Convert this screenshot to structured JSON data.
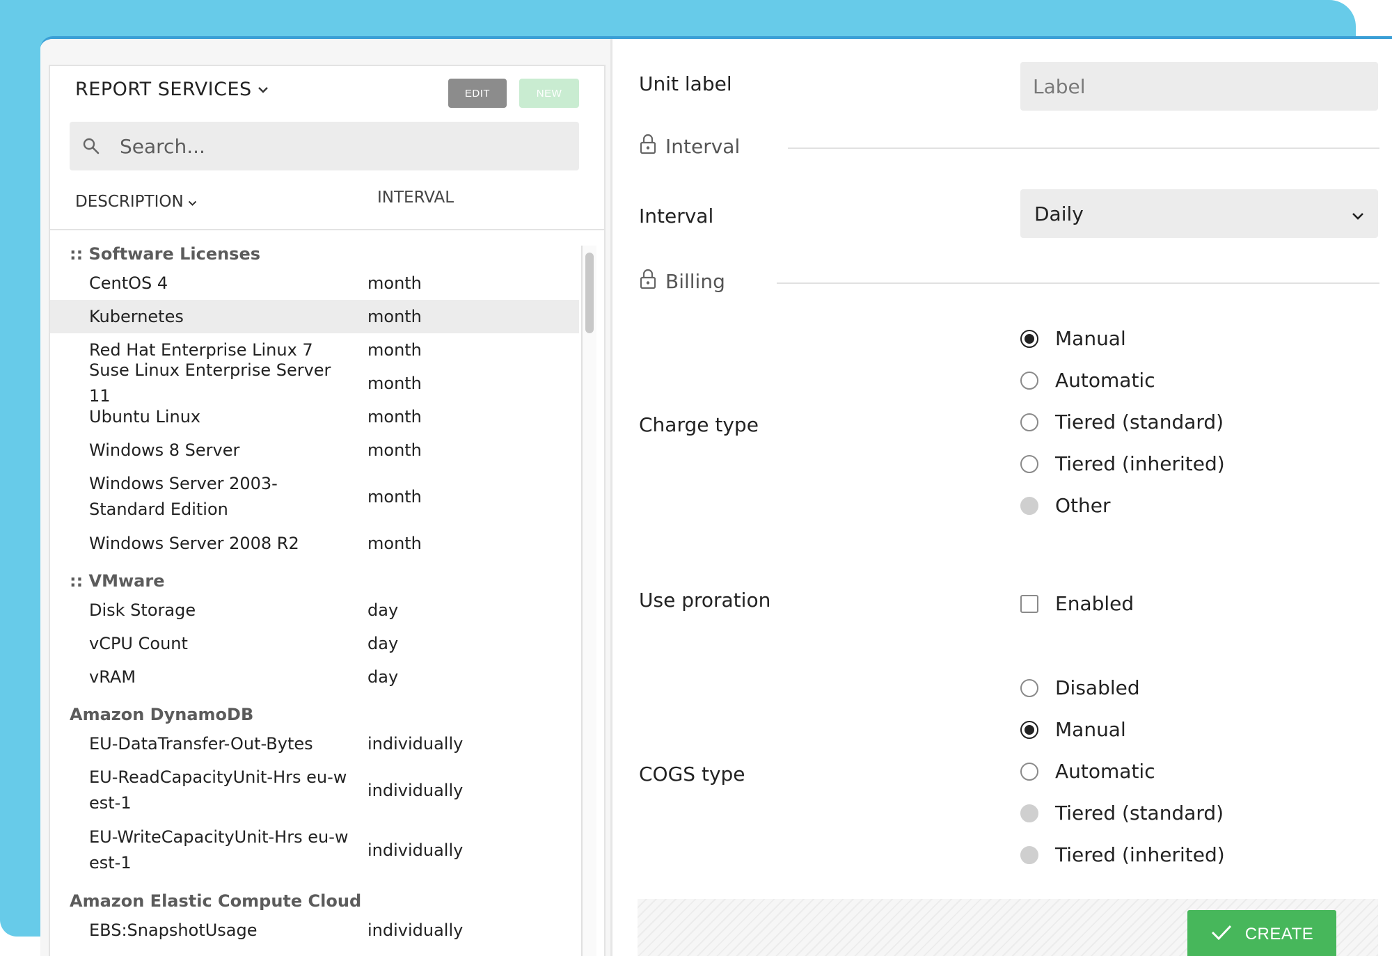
{
  "left_panel": {
    "title": "REPORT SERVICES",
    "edit_label": "EDIT",
    "new_label": "NEW",
    "search_placeholder": "Search...",
    "columns": {
      "description": "DESCRIPTION",
      "interval": "INTERVAL"
    },
    "groups": [
      {
        "name": ":: Software Licenses",
        "items": [
          {
            "description": "CentOS 4",
            "interval": "month"
          },
          {
            "description": "Kubernetes",
            "interval": "month",
            "selected": true
          },
          {
            "description": "Red Hat Enterprise Linux 7",
            "interval": "month"
          },
          {
            "description": "Suse Linux Enterprise Server 11",
            "interval": "month"
          },
          {
            "description": "Ubuntu Linux",
            "interval": "month"
          },
          {
            "description": "Windows 8 Server",
            "interval": "month"
          },
          {
            "description": "Windows Server 2003- Standard Edition",
            "interval": "month"
          },
          {
            "description": "Windows Server 2008 R2",
            "interval": "month"
          }
        ]
      },
      {
        "name": ":: VMware",
        "items": [
          {
            "description": "Disk Storage",
            "interval": "day"
          },
          {
            "description": "vCPU Count",
            "interval": "day"
          },
          {
            "description": "vRAM",
            "interval": "day"
          }
        ]
      },
      {
        "name": "Amazon DynamoDB",
        "items": [
          {
            "description": "EU-DataTransfer-Out-Bytes",
            "interval": "individually"
          },
          {
            "description": "EU-ReadCapacityUnit-Hrs eu-west-1",
            "interval": "individually"
          },
          {
            "description": "EU-WriteCapacityUnit-Hrs eu-west-1",
            "interval": "individually"
          }
        ]
      },
      {
        "name": "Amazon Elastic Compute Cloud",
        "items": [
          {
            "description": "EBS:SnapshotUsage",
            "interval": "individually"
          }
        ]
      }
    ]
  },
  "form": {
    "unit_label": {
      "label": "Unit label",
      "placeholder": "Label"
    },
    "interval_section": "Interval",
    "interval_field": {
      "label": "Interval",
      "value": "Daily"
    },
    "billing_section": "Billing",
    "charge_type": {
      "label": "Charge type",
      "options": [
        {
          "label": "Manual",
          "state": "checked"
        },
        {
          "label": "Automatic",
          "state": "unchecked"
        },
        {
          "label": "Tiered (standard)",
          "state": "unchecked"
        },
        {
          "label": "Tiered (inherited)",
          "state": "unchecked"
        },
        {
          "label": "Other",
          "state": "disabled"
        }
      ]
    },
    "use_proration": {
      "label": "Use proration",
      "option_label": "Enabled",
      "checked": false
    },
    "cogs_type": {
      "label": "COGS type",
      "options": [
        {
          "label": "Disabled",
          "state": "unchecked"
        },
        {
          "label": "Manual",
          "state": "checked"
        },
        {
          "label": "Automatic",
          "state": "unchecked"
        },
        {
          "label": "Tiered (standard)",
          "state": "disabled"
        },
        {
          "label": "Tiered (inherited)",
          "state": "disabled"
        }
      ]
    },
    "create_label": "CREATE"
  },
  "colors": {
    "backdrop": "#67cbe9",
    "window_border": "#3a9fd6",
    "create_button": "#47b75b",
    "new_button": "#c9ecd1",
    "edit_button": "#8c8c8c"
  }
}
